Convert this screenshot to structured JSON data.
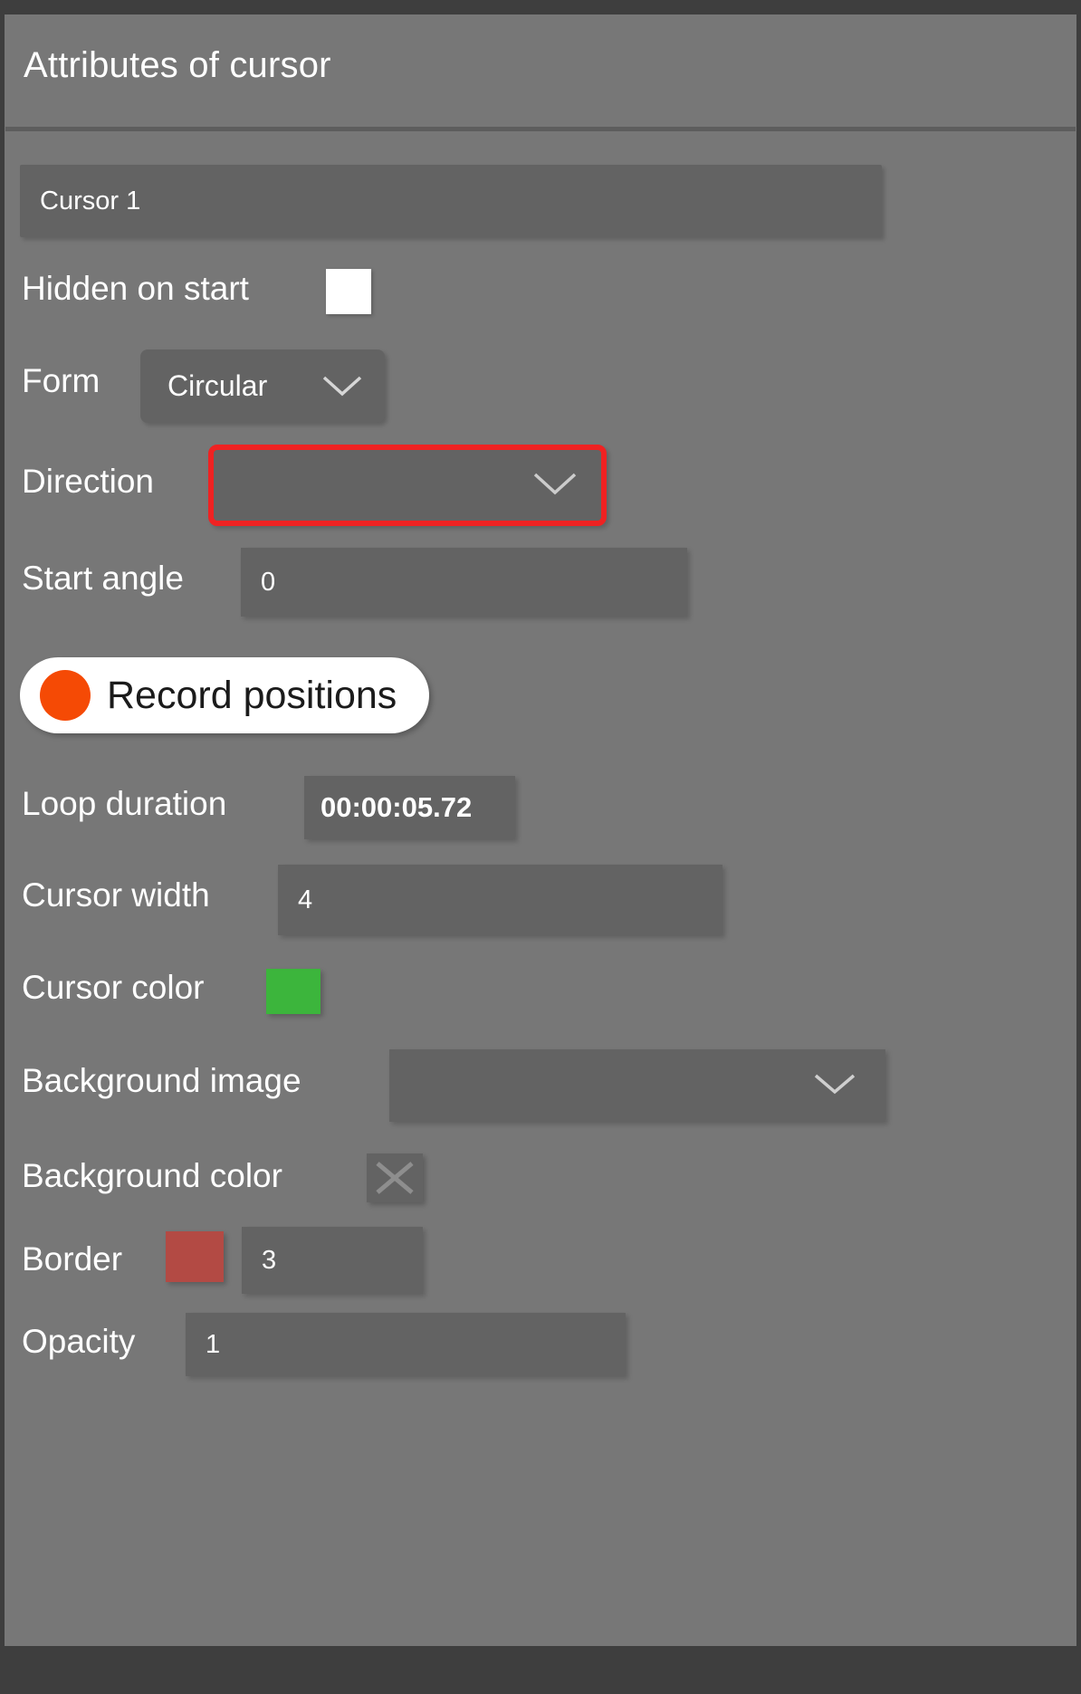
{
  "panel": {
    "title": "Attributes of cursor"
  },
  "colors": {
    "panel_bg": "#777777",
    "field_bg": "#636363",
    "chrome_dark": "#3e3e3e",
    "highlight_border": "#ef2222",
    "record_dot": "#f54a05",
    "cursor_color": "#3cb53c",
    "border_color": "#b34a44",
    "text": "#ffffff"
  },
  "fields": {
    "name": {
      "value": "Cursor 1",
      "placeholder": "Cursor name"
    },
    "hidden_on_start": {
      "label": "Hidden on start",
      "checked": false
    },
    "form": {
      "label": "Form",
      "value": "Circular",
      "chevron": "chevron-down-icon"
    },
    "direction": {
      "label": "Direction",
      "value": "",
      "placeholder": "",
      "chevron": "chevron-down-icon",
      "highlighted": true
    },
    "start_angle": {
      "label": "Start angle",
      "value": "0"
    },
    "record_positions": {
      "label": "Record positions",
      "icon": "record-dot-icon"
    },
    "loop_duration": {
      "label": "Loop duration",
      "value": "00:00:05.72"
    },
    "cursor_width": {
      "label": "Cursor width",
      "value": "4"
    },
    "cursor_color": {
      "label": "Cursor color",
      "value": "#3cb53c"
    },
    "background_image": {
      "label": "Background image",
      "value": "",
      "chevron": "chevron-down-icon"
    },
    "background_color": {
      "label": "Background color",
      "value": "",
      "icon": "close-x-icon"
    },
    "border": {
      "label": "Border",
      "color": "#b34a44",
      "value": "3"
    },
    "opacity": {
      "label": "Opacity",
      "value": "1"
    }
  }
}
